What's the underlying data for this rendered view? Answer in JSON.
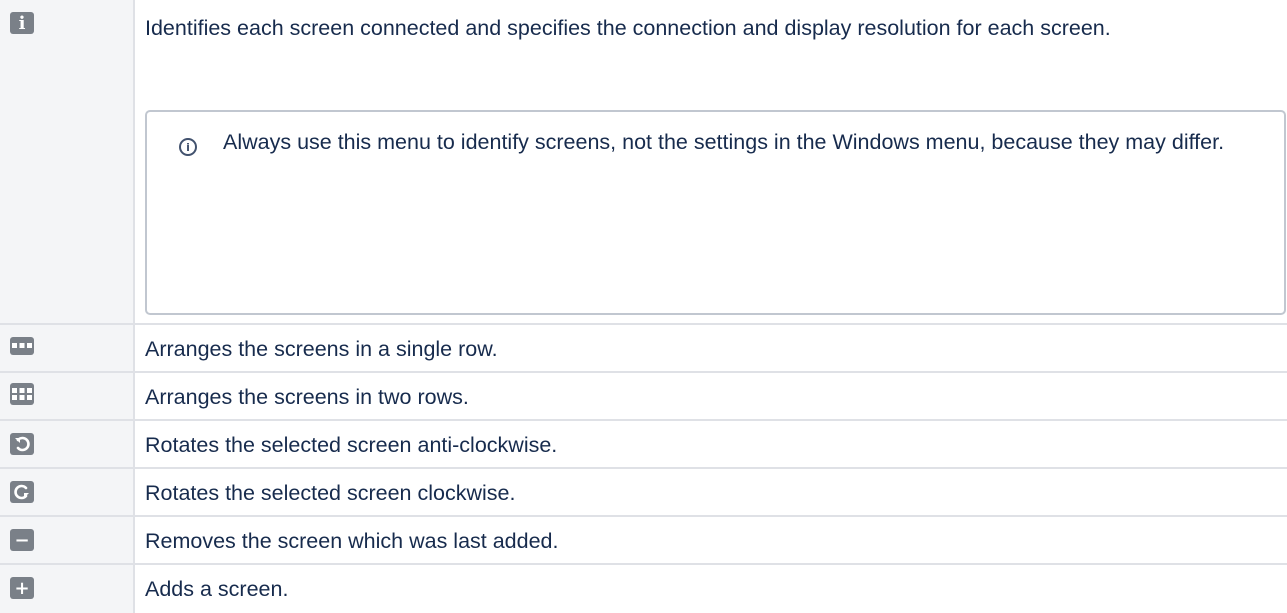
{
  "rows": [
    {
      "icon": "info-icon",
      "text": "Identifies each screen connected and specifies the connection and display resolution for each screen.",
      "note": "Always use this menu to identify screens, not the settings in the Windows menu, because they may differ."
    },
    {
      "icon": "single-row-layout-icon",
      "text": "Arranges the screens in a single row."
    },
    {
      "icon": "two-rows-layout-icon",
      "text": "Arranges the screens in two rows."
    },
    {
      "icon": "rotate-anticlockwise-icon",
      "text": "Rotates the selected screen anti-clockwise."
    },
    {
      "icon": "rotate-clockwise-icon",
      "text": "Rotates the selected screen clockwise."
    },
    {
      "icon": "remove-screen-icon",
      "text": "Removes the screen which was last added."
    },
    {
      "icon": "add-screen-icon",
      "text": "Adds a screen."
    }
  ],
  "note_symbol": "i",
  "icon_glyphs": {
    "info": "i",
    "minus": "−",
    "plus": "+"
  },
  "colors": {
    "icon_background": "#7a8088",
    "icon_cell_background": "#f4f5f7",
    "border": "#dfe1e6",
    "note_border": "#c1c7d0",
    "text": "#172b4d"
  }
}
